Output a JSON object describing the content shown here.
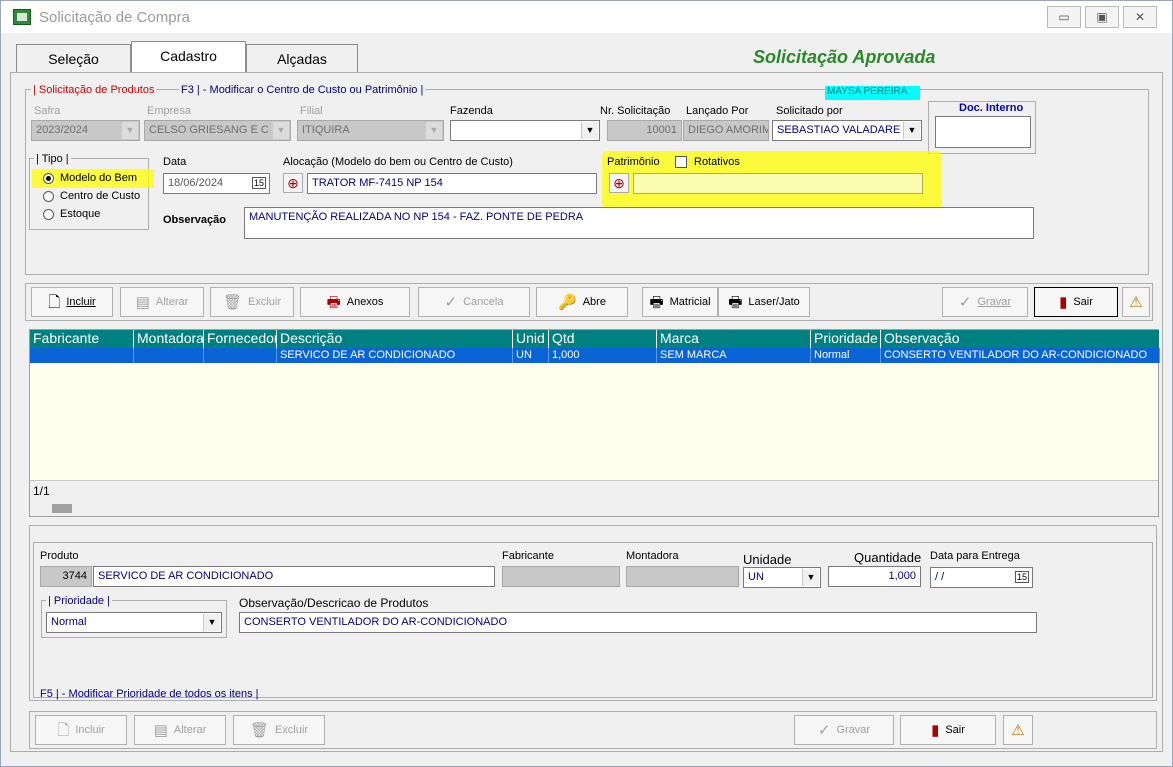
{
  "window": {
    "title": "Solicitação de Compra",
    "minimize": "▭",
    "maximize": "▣",
    "close": "✕"
  },
  "tabs": [
    {
      "label": "Seleção"
    },
    {
      "label": "Cadastro"
    },
    {
      "label": "Alçadas"
    }
  ],
  "status_banner": "Solicitação Aprovada",
  "header": {
    "section_label": "| Solicitação de Produtos",
    "f3_hint": "F3 | - Modificar o Centro de Custo ou Patrimônio |",
    "user_badge": "MAYSA PEREIRA"
  },
  "form": {
    "safra": {
      "label": "Safra",
      "value": "2023/2024"
    },
    "empresa": {
      "label": "Empresa",
      "value": "CELSO GRIESANG E C"
    },
    "filial": {
      "label": "Filial",
      "value": "ITIQUIRA"
    },
    "fazenda": {
      "label": "Fazenda",
      "value": ""
    },
    "nr_solicitacao": {
      "label": "Nr. Solicitação",
      "value": "10001"
    },
    "lancado_por": {
      "label": "Lançado Por",
      "value": "DIEGO AMORIM"
    },
    "solicitado_por": {
      "label": "Solicitado por",
      "value": "SEBASTIAO VALADARE"
    },
    "doc_interno": {
      "label": "Doc. Interno",
      "value": ""
    },
    "tipo": {
      "label": "| Tipo |",
      "options": [
        "Modelo do Bem",
        "Centro de Custo",
        "Estoque"
      ],
      "selected": "Modelo do Bem"
    },
    "data": {
      "label": "Data",
      "value": "18/06/2024"
    },
    "alocacao": {
      "label": "Alocação (Modelo do bem ou Centro de Custo)",
      "value": "TRATOR MF-7415 NP 154"
    },
    "patrimonio": {
      "label": "Patrimônio",
      "rotativos_label": "Rotativos",
      "value": ""
    },
    "observacao": {
      "label": "Observação",
      "value": "MANUTENÇÃO REALIZADA NO NP 154  - FAZ. PONTE DE PEDRA"
    }
  },
  "toolbar": {
    "incluir": "Incluir",
    "alterar": "Alterar",
    "excluir": "Excluir",
    "anexos": "Anexos",
    "cancela": "Cancela",
    "abre": "Abre",
    "matricial": "Matricial",
    "laser": "Laser/Jato",
    "gravar": "Gravar",
    "sair": "Sair"
  },
  "grid": {
    "columns": [
      "Fabricante",
      "Montadora",
      "Fornecedor",
      "Descrição",
      "Unid",
      "Qtd",
      "Marca",
      "Prioridade",
      "Observação"
    ],
    "rows": [
      [
        "",
        "",
        "",
        "SERVICO DE AR CONDICIONADO",
        "UN",
        "1,000",
        "SEM MARCA",
        "Normal",
        "CONSERTO VENTILADOR DO AR-CONDICIONADO"
      ]
    ],
    "record_counter": "1/1"
  },
  "item_form": {
    "produto": {
      "label": "Produto",
      "code": "3744",
      "value": "SERVICO DE AR CONDICIONADO"
    },
    "fabricante": {
      "label": "Fabricante",
      "value": ""
    },
    "montadora": {
      "label": "Montadora",
      "value": ""
    },
    "unidade": {
      "label": "Unidade",
      "value": "UN"
    },
    "quantidade": {
      "label": "Quantidade",
      "value": "1,000"
    },
    "data_entrega": {
      "label": "Data para Entrega",
      "value": " / /"
    },
    "prioridade": {
      "label": "| Prioridade |",
      "value": "Normal"
    },
    "observacao": {
      "label": "Observação/Descricao de Produtos",
      "value": "CONSERTO VENTILADOR DO AR-CONDICIONADO"
    },
    "f5_hint": "F5 | - Modificar Prioridade de todos os itens |"
  },
  "bottom_toolbar": {
    "incluir": "Incluir",
    "alterar": "Alterar",
    "excluir": "Excluir",
    "gravar": "Gravar",
    "sair": "Sair"
  },
  "colors": {
    "accent_green": "#2a8a2a",
    "grid_header": "#008080",
    "grid_selected": "#0a64d8",
    "highlight": "#ffff00"
  }
}
